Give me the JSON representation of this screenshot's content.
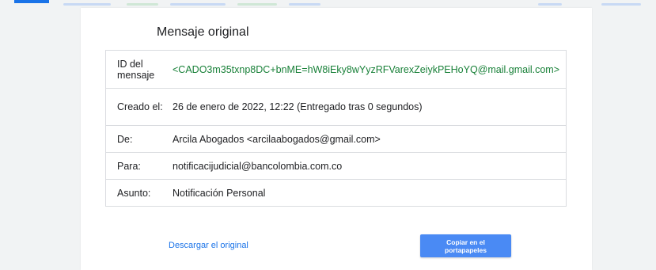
{
  "title": "Mensaje original",
  "colors": {
    "accent": "#1a73e8",
    "message_id": "#188038",
    "button_bg": "#4a8af4"
  },
  "rows": [
    {
      "label": "ID del mensaje",
      "value": "<CADO3m35txnp8DC+bnME=hW8iEky8wYyzRFVarexZeiykPEHoYQ@mail.gmail.com>"
    },
    {
      "label": "Creado el:",
      "value": "26 de enero de 2022, 12:22 (Entregado tras 0 segundos)"
    },
    {
      "label": "De:",
      "value": "Arcila Abogados <arcilaabogados@gmail.com>"
    },
    {
      "label": "Para:",
      "value": "notificacijudicial@bancolombia.com.co"
    },
    {
      "label": "Asunto:",
      "value": "Notificación Personal"
    }
  ],
  "actions": {
    "download_label": "Descargar el original",
    "copy_label": "Copiar en el portapapeles"
  }
}
